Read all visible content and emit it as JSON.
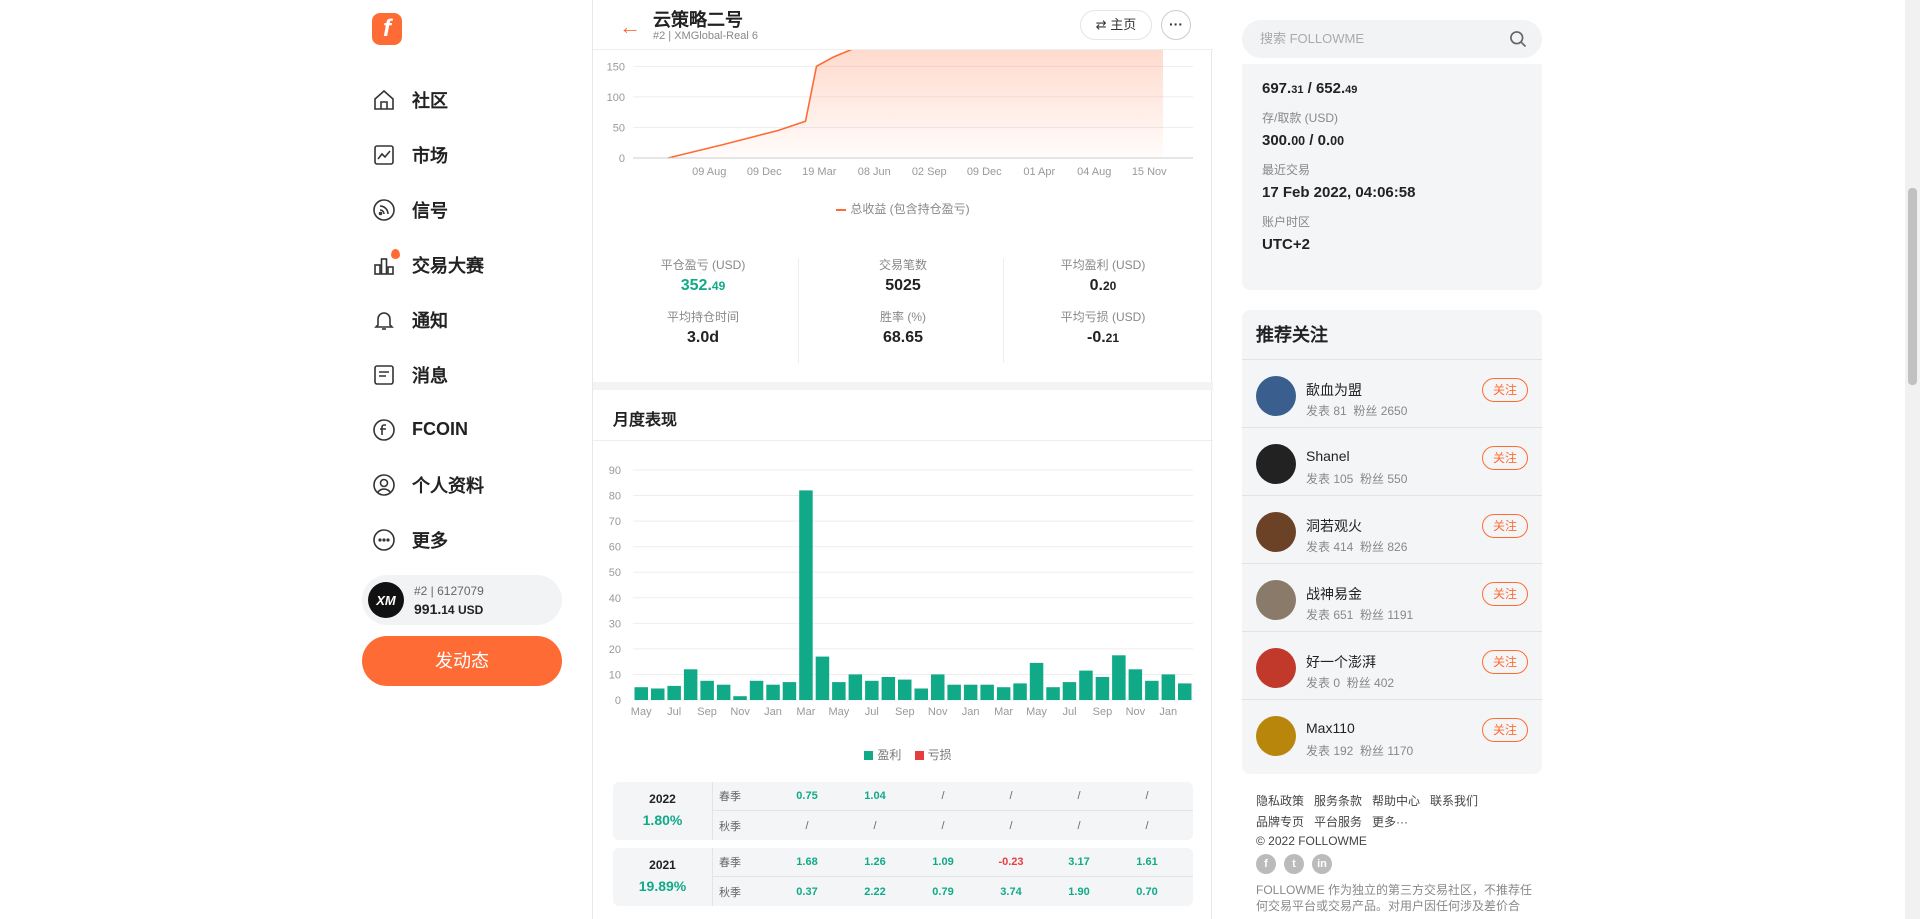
{
  "nav": {
    "logo": "f",
    "items": [
      {
        "label": "社区",
        "icon": "home-icon"
      },
      {
        "label": "市场",
        "icon": "chart-icon"
      },
      {
        "label": "信号",
        "icon": "rss-icon"
      },
      {
        "label": "交易大赛",
        "icon": "trophy-icon"
      },
      {
        "label": "通知",
        "icon": "bell-icon"
      },
      {
        "label": "消息",
        "icon": "message-icon"
      },
      {
        "label": "FCOIN",
        "icon": "coin-icon"
      },
      {
        "label": "个人资料",
        "icon": "user-icon"
      },
      {
        "label": "更多",
        "icon": "more-icon"
      }
    ],
    "account": {
      "logo": "XM",
      "id": "#2 | 6127079",
      "balance_int": "991.",
      "balance_dec": "14",
      "currency": "USD"
    },
    "post_button": "发动态"
  },
  "header": {
    "title": "云策略二号",
    "subtitle": "#2 | XMGlobal-Real 6",
    "home_button": "⇄ 主页",
    "more_button": "···"
  },
  "chart_data": [
    {
      "type": "area",
      "title": "",
      "legend": [
        "总收益 (包含持仓盈亏)"
      ],
      "y_ticks": [
        0,
        50,
        100,
        150
      ],
      "x_ticks": [
        "09 Aug",
        "09 Dec",
        "19 Mar",
        "08 Jun",
        "02 Sep",
        "09 Dec",
        "01 Apr",
        "04 Aug",
        "15 Nov"
      ],
      "series": [
        {
          "name": "总收益 (包含持仓盈亏)",
          "x_index": [
            0,
            1,
            2,
            2.5,
            2.7,
            3.0,
            3.4,
            4,
            5,
            6,
            7,
            8,
            9
          ],
          "values": [
            0,
            22,
            45,
            60,
            150,
            165,
            180,
            200,
            225,
            250,
            275,
            300,
            330
          ]
        }
      ],
      "ylim": [
        0,
        180
      ]
    },
    {
      "type": "bar",
      "title": "月度表现",
      "legend": [
        "盈利",
        "亏损"
      ],
      "y_ticks": [
        0,
        10,
        20,
        30,
        40,
        50,
        60,
        70,
        80,
        90
      ],
      "ylim": [
        0,
        90
      ],
      "x_tick_labels": [
        "May",
        "Jul",
        "Sep",
        "Nov",
        "Jan",
        "Mar",
        "May",
        "Jul",
        "Sep",
        "Nov",
        "Jan",
        "Mar",
        "May",
        "Jul",
        "Sep",
        "Nov",
        "Jan"
      ],
      "series": [
        {
          "name": "盈利",
          "values": [
            5,
            4.5,
            5.5,
            12,
            7.5,
            6,
            1.5,
            7.5,
            6,
            7,
            82,
            17,
            7,
            10,
            7.5,
            9,
            8,
            4.5,
            10,
            6,
            6,
            6,
            5,
            6.5,
            14.5,
            5,
            7,
            11.5,
            9,
            17.5,
            12,
            7.5,
            10,
            6.5
          ]
        }
      ]
    }
  ],
  "stats": [
    {
      "label": "平仓盈亏 (USD)",
      "int": "352.",
      "dec": "49",
      "color": "green"
    },
    {
      "label": "交易笔数",
      "int": "5025",
      "dec": ""
    },
    {
      "label": "平均盈利 (USD)",
      "int": "0.",
      "dec": "20"
    },
    {
      "label": "平均持仓时间",
      "int": "3.0d",
      "dec": ""
    },
    {
      "label": "胜率 (%)",
      "int": "68.65",
      "dec": ""
    },
    {
      "label": "平均亏损 (USD)",
      "int": "-0.",
      "dec": "21"
    }
  ],
  "monthly": {
    "title": "月度表现",
    "years": [
      {
        "year": "2022",
        "pct": "1.80%",
        "spring_label": "春季",
        "autumn_label": "秋季",
        "spring": [
          "0.75",
          "1.04",
          "/",
          "/",
          "/",
          "/"
        ],
        "autumn": [
          "/",
          "/",
          "/",
          "/",
          "/",
          "/"
        ]
      },
      {
        "year": "2021",
        "pct": "19.89%",
        "spring_label": "春季",
        "autumn_label": "秋季",
        "spring": [
          "1.68",
          "1.26",
          "1.09",
          "-0.23",
          "3.17",
          "1.61"
        ],
        "autumn": [
          "0.37",
          "2.22",
          "0.79",
          "3.74",
          "1.90",
          "0.70"
        ]
      }
    ]
  },
  "info": {
    "equity_int1": "697.",
    "equity_dec1": "31",
    "sep": " / ",
    "equity_int2": "652.",
    "equity_dec2": "49",
    "deposit_label": "存/取款 (USD)",
    "deposit_int1": "300.",
    "deposit_dec1": "00",
    "deposit_int2": "0.",
    "deposit_dec2": "00",
    "last_trade_label": "最近交易",
    "last_trade": "17 Feb 2022, 04:06:58",
    "tz_label": "账户时区",
    "tz": "UTC+2"
  },
  "search": {
    "placeholder": "搜索 FOLLOWME"
  },
  "recommend": {
    "title": "推荐关注",
    "follow_label": "关注",
    "users": [
      {
        "name": "歃血为盟",
        "posts": "发表 81",
        "fans": "粉丝 2650",
        "color": "#3a5f8f"
      },
      {
        "name": "Shanel",
        "posts": "发表 105",
        "fans": "粉丝 550",
        "color": "#222222"
      },
      {
        "name": "洞若观火",
        "posts": "发表 414",
        "fans": "粉丝 826",
        "color": "#6b4226"
      },
      {
        "name": "战神易金",
        "posts": "发表 651",
        "fans": "粉丝 1191",
        "color": "#8a7a6a"
      },
      {
        "name": "好一个澎湃",
        "posts": "发表 0",
        "fans": "粉丝 402",
        "color": "#c0392b"
      },
      {
        "name": "Max110",
        "posts": "发表 192",
        "fans": "粉丝 1170",
        "color": "#b8860b"
      }
    ]
  },
  "footer": {
    "links1": [
      "隐私政策",
      "服务条款",
      "帮助中心",
      "联系我们"
    ],
    "links2": [
      "品牌专页",
      "平台服务",
      "更多···"
    ],
    "copyright": "© 2022 FOLLOWME",
    "social": [
      "f",
      "t",
      "in"
    ],
    "desc": "FOLLOWME 作为独立的第三方交易社区，不推荐任何交易平台或交易产品。对用户因任何涉及差价合"
  },
  "colors": {
    "accent": "#ff6b35",
    "green": "#11aa88",
    "red": "#e53e3e"
  }
}
